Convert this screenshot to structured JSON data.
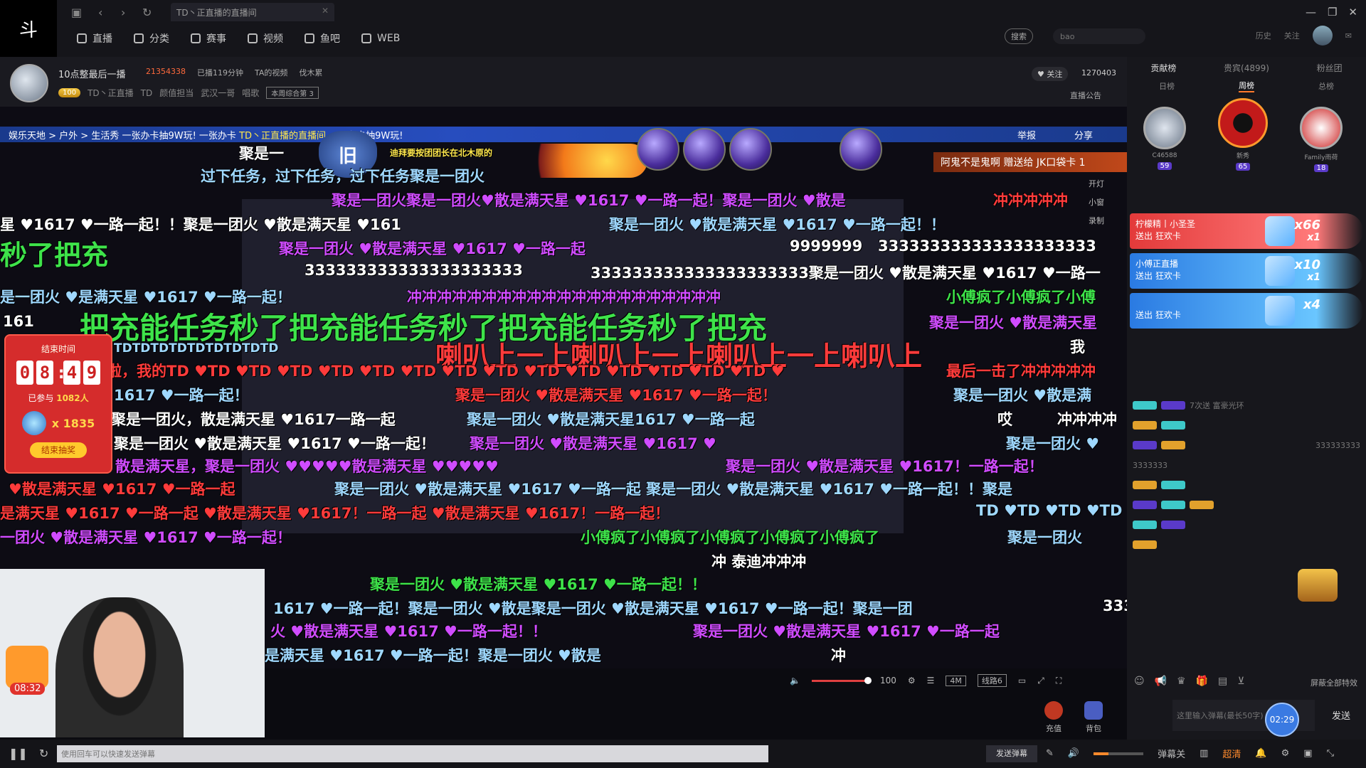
{
  "window": {
    "logo": "斗",
    "tab_title": "TD丶正直播的直播间",
    "controls": [
      "—",
      "❐",
      "✕"
    ]
  },
  "menu": [
    {
      "label": "直播",
      "icon": "tv-icon"
    },
    {
      "label": "分类",
      "icon": "grid-icon"
    },
    {
      "label": "赛事",
      "icon": "trophy-icon"
    },
    {
      "label": "视频",
      "icon": "video-icon"
    },
    {
      "label": "鱼吧",
      "icon": "fish-icon"
    },
    {
      "label": "WEB",
      "icon": "globe-icon"
    }
  ],
  "search": {
    "button": "搜索",
    "placeholder": "bao"
  },
  "top_right": {
    "items": [
      "历史",
      "关注"
    ]
  },
  "room": {
    "title": "10点整最后一播",
    "hot": "21354338",
    "duration": "已播119分钟",
    "video": "TA的视频",
    "fans_group": "伐木累",
    "tags": [
      "TD丶正直播",
      "TD",
      "颜值担当",
      "武汉一哥",
      "唱歌"
    ],
    "weekly": "本周综合第 3",
    "level": "100",
    "follow_label": "关注",
    "follow_count": "1270403",
    "announce": "直播公告"
  },
  "notice": {
    "text": "娱乐天地 > 户外 > 生活秀 一张办卡抽9W玩! 一张办卡",
    "highlight": "TD丶正直播的直播间",
    "tail": "一张办卡抽9W玩!",
    "report": "举报",
    "share": "分享"
  },
  "gift_banner": "阿鬼不是鬼啊 赠送给 JK口袋卡 1",
  "gift_notice": "迪拜要按团团长在北木原的",
  "shield_text": "旧",
  "side_options": [
    "开灯",
    "小窗",
    "录制"
  ],
  "danmaku": [
    {
      "text": "聚是一",
      "color": "c-w"
    },
    {
      "text": "过下任务，过下任务，过下任务聚是一团火",
      "color": "c-b"
    },
    {
      "text": "聚是一团火聚是一团火♥散是满天星 ♥1617 ♥一路一起！聚是一团火 ♥散是",
      "color": "c-p"
    },
    {
      "text": "冲冲冲冲冲",
      "color": "c-r"
    },
    {
      "text": "星 ♥1617 ♥一路一起！！聚是一团火 ♥散是满天星 ♥161",
      "color": "c-w"
    },
    {
      "text": "聚是一团火 ♥散是满天星 ♥1617 ♥一路一起！！",
      "color": "c-b"
    },
    {
      "text": "秒了把充",
      "color": "c-g"
    },
    {
      "text": "聚是一团火 ♥散是满天星 ♥1617 ♥一路一起",
      "color": "c-p"
    },
    {
      "text": "9999999",
      "color": "c-w"
    },
    {
      "text": "333333333333333333333",
      "color": "c-w"
    },
    {
      "text": "333333333333333333333",
      "color": "c-w"
    },
    {
      "text": "333333333333333333333聚是一团火 ♥散是满天星 ♥1617 ♥一路一",
      "color": "c-w"
    },
    {
      "text": "是一团火 ♥是满天星 ♥1617 ♥一路一起！",
      "color": "c-b"
    },
    {
      "text": "冲冲冲冲冲冲冲冲冲冲冲冲冲冲冲冲冲冲冲冲冲",
      "color": "c-p"
    },
    {
      "text": "小傅疯了小傅疯了小傅",
      "color": "c-g"
    },
    {
      "text": "161",
      "color": "c-w"
    },
    {
      "text": "把充能任务秒了把充能任务秒了把充能任务秒了把充",
      "color": "c-g"
    },
    {
      "text": "聚是一团火 ♥散是满天星",
      "color": "c-p"
    },
    {
      "text": "喇叭上一上喇叭上一上喇叭上一上喇叭上",
      "color": "c-r"
    },
    {
      "text": "我",
      "color": "c-w"
    },
    {
      "text": "TDTDTDTDTDTDTDTDTD",
      "color": "c-b"
    },
    {
      "text": "啦，我的TD ♥TD ♥TD ♥TD ♥TD ♥TD ♥TD ♥TD ♥TD ♥TD ♥TD ♥TD ♥TD ♥TD ♥TD ♥",
      "color": "c-r"
    },
    {
      "text": "最后一击了冲冲冲冲冲",
      "color": "c-r"
    },
    {
      "text": "1617 ♥一路一起！",
      "color": "c-b"
    },
    {
      "text": "聚是一团火 ♥散是满天星 ♥1617 ♥一路一起！",
      "color": "c-r"
    },
    {
      "text": "聚是一团火 ♥散是满",
      "color": "c-b"
    },
    {
      "text": "聚是一团火，散是满天星 ♥1617一路一起",
      "color": "c-w"
    },
    {
      "text": "聚是一团火 ♥散是满天星1617 ♥一路一起",
      "color": "c-b"
    },
    {
      "text": "哎",
      "color": "c-w"
    },
    {
      "text": "冲冲冲冲",
      "color": "c-w"
    },
    {
      "text": "聚是一团火 ♥散是满天星 ♥1617 ♥一路一起！",
      "color": "c-w"
    },
    {
      "text": "聚是一团火 ♥散是满天星 ♥1617 ♥",
      "color": "c-p"
    },
    {
      "text": "聚是一团火 ♥",
      "color": "c-b"
    },
    {
      "text": "散是满天星，聚是一团火 ♥♥♥♥♥散是满天星 ♥♥♥♥♥",
      "color": "c-p"
    },
    {
      "text": "聚是一团火 ♥散是满天星 ♥1617！一路一起！",
      "color": "c-p"
    },
    {
      "text": "♥散是满天星 ♥1617 ♥一路一起",
      "color": "c-r"
    },
    {
      "text": "聚是一团火 ♥散是满天星 ♥1617 ♥一路一起 聚是一团火 ♥散是满天星 ♥1617 ♥一路一起！！聚是",
      "color": "c-b"
    },
    {
      "text": "是满天星 ♥1617 ♥一路一起 ♥散是满天星 ♥1617！一路一起 ♥散是满天星 ♥1617！一路一起！",
      "color": "c-r"
    },
    {
      "text": "TD ♥TD ♥TD ♥TD",
      "color": "c-b"
    },
    {
      "text": "一团火 ♥散是满天星 ♥1617 ♥一路一起！",
      "color": "c-p"
    },
    {
      "text": "小傅疯了小傅疯了小傅疯了小傅疯了小傅疯了",
      "color": "c-g"
    },
    {
      "text": "聚是一团火",
      "color": "c-b"
    },
    {
      "text": "冲  泰迪冲冲冲",
      "color": "c-w"
    },
    {
      "text": "聚是一团火 ♥散是满天星 ♥1617 ♥一路一起！！",
      "color": "c-g"
    },
    {
      "text": "1617 ♥一路一起！聚是一团火 ♥散是聚是一团火 ♥散是满天星 ♥1617 ♥一路一起！聚是一团",
      "color": "c-b"
    },
    {
      "text": "333",
      "color": "c-w"
    },
    {
      "text": "火 ♥散是满天星 ♥1617 ♥一路一起！！",
      "color": "c-p"
    },
    {
      "text": "聚是一团火 ♥散是满天星 ♥1617 ♥一路一起",
      "color": "c-p"
    },
    {
      "text": "是满天星 ♥1617 ♥一路一起！聚是一团火 ♥散是",
      "color": "c-b"
    },
    {
      "text": "冲",
      "color": "c-w"
    }
  ],
  "lottery": {
    "label": "结束时间",
    "digits": [
      "0",
      "8",
      "4",
      "9"
    ],
    "joined_label": "已参与",
    "joined_count": "1082人",
    "gift_count": "x 1835",
    "end_button": "结束抽奖"
  },
  "cam": {
    "badge_time": "08:32"
  },
  "player": {
    "volume": "100",
    "quality": "4M",
    "line": "线路6"
  },
  "actions": {
    "charge": "充值",
    "bag": "背包"
  },
  "bottom": {
    "input_placeholder": "使用回车可以快速发送弹幕",
    "send_danmaku": "发送弹幕",
    "danmaku_toggle": "弹幕关",
    "barrage_style": "超清"
  },
  "rank": {
    "tabs": [
      "贡献榜",
      "贵宾(4899)",
      "粉丝团"
    ],
    "sub_tabs": [
      "日榜",
      "周榜",
      "总榜"
    ],
    "podium": [
      {
        "name": "C46588",
        "level": "59",
        "place": "2"
      },
      {
        "name": "新秀",
        "level": "65",
        "place": "1"
      },
      {
        "name": "Family雨荷",
        "level": "18",
        "place": "3"
      }
    ]
  },
  "gift_feed": [
    {
      "sender": "柠檬精丨小圣圣",
      "action": "送出 狂欢卡",
      "count": "x66",
      "sub": "x1",
      "style": "red"
    },
    {
      "sender": "小傅正直播",
      "action": "送出 狂欢卡",
      "count": "x10",
      "sub": "x1",
      "style": "blue"
    },
    {
      "sender": "送出 狂欢卡",
      "action": "",
      "count": "x4",
      "sub": "",
      "style": "blue"
    }
  ],
  "chat": {
    "lines": [
      "7次送 富豪光环",
      "3333333",
      "333333333"
    ],
    "input_placeholder": "这里输入弹幕(最长50字)",
    "timer": "02:29",
    "send": "发送",
    "block_all": "屏蔽全部特效"
  }
}
